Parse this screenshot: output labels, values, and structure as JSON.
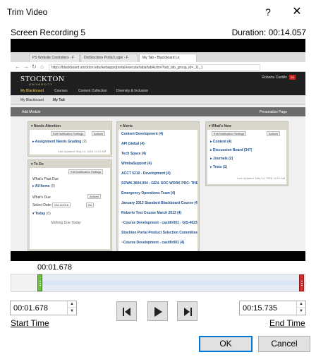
{
  "window": {
    "title": "Trim Video",
    "help_label": "?",
    "close_label": "✕"
  },
  "recording": {
    "name": "Screen Recording 5",
    "duration": "Duration: 00:14.057"
  },
  "preview": {
    "browser_tabs": [
      "PS Website Controllers - F",
      "DotStockton Portal Login - F",
      "My Tab - Blackboard Le"
    ],
    "url": "https://blackboard.stockton.edu/webapps/portal/execute/tabs/tabAction?tab_tab_group_id=_11_1",
    "site_logo": "STOCKTON",
    "site_logo_sub": "UNIVERSITY",
    "site_nav": [
      "My Blackboard",
      "Courses",
      "Content Collection",
      "Diversity & Inclusion"
    ],
    "user_name": "Roberta Castillo",
    "user_badge": "24",
    "my_tabs": [
      "My Blackboard",
      "My Tab"
    ],
    "add_module": "Add Module",
    "personalize": "Personalize Page",
    "needs_attention": {
      "title": "Needs Attention",
      "edit_btn": "Edit Notification Settings",
      "actions": "Actions",
      "item": "Assignment Needs Grading",
      "item_count": "(2)",
      "updated": "Last Updated: May 14, 2018 10:21 AM"
    },
    "todo": {
      "title": "To Do",
      "edit_btn": "Edit Notification Settings",
      "past_due": "What's Past Due",
      "all_items": "All Items",
      "all_items_count": "(0)",
      "whats_due": "What's Due",
      "actions": "Actions",
      "select_date": "Select Date:",
      "date_value": "05/14/2018",
      "go": "Go",
      "today": "Today",
      "today_count": "(0)",
      "nothing_due": "Nothing Due Today"
    },
    "alerts": {
      "title": "Alerts",
      "items": [
        "Content Development (4)",
        "API Global (4)",
        "Tech Space (4)",
        "WimbaSupport (4)",
        "ACCT 5210 - Development (4)",
        "SOWK.3604.004 - GEN. SOC WORK PRC: THE & METT (4)",
        "Emergency Operations Team (4)",
        "January 2013 Standard Blackboard Course (4)",
        "Roberto Test Course March 2013 (4)",
        "~Course Development - castillr001 - GIS-4623-001 Fall 2011 (4)",
        "Stockton Portal Product Selection Committee (4)",
        "~Course Development - castillr001 (4)"
      ]
    },
    "whats_new": {
      "title": "What's New",
      "edit_btn": "Edit Notification Settings",
      "actions": "Actions",
      "items": [
        "Content (4)",
        "Discussion Board (347)",
        "Journals (2)",
        "Tests (1)"
      ],
      "updated": "Last Updated: May 14, 2018 10:21 AM"
    }
  },
  "trim": {
    "current_time": "00:01.678",
    "start_fraction": 0.119,
    "end_fraction": 1.0,
    "start_value": "00:01.678",
    "end_value": "00:15.735",
    "start_label": "Start Time",
    "end_label": "End Time",
    "spin_up": "▲",
    "spin_down": "▼"
  },
  "controls": {
    "step_back": "previous-frame",
    "play": "play",
    "step_forward": "next-frame"
  },
  "buttons": {
    "ok": "OK",
    "cancel": "Cancel"
  },
  "colors": {
    "start_handle": "#6abf3c",
    "end_handle": "#d32f2f",
    "default_button_border": "#0078d7"
  }
}
